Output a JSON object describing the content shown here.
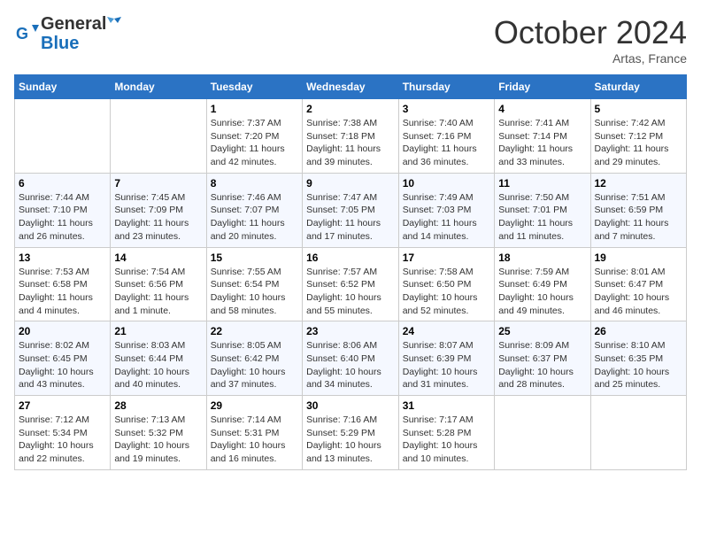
{
  "header": {
    "logo_line1": "General",
    "logo_line2": "Blue",
    "month": "October 2024",
    "location": "Artas, France"
  },
  "days_of_week": [
    "Sunday",
    "Monday",
    "Tuesday",
    "Wednesday",
    "Thursday",
    "Friday",
    "Saturday"
  ],
  "weeks": [
    [
      {
        "num": "",
        "info": ""
      },
      {
        "num": "",
        "info": ""
      },
      {
        "num": "1",
        "info": "Sunrise: 7:37 AM\nSunset: 7:20 PM\nDaylight: 11 hours and 42 minutes."
      },
      {
        "num": "2",
        "info": "Sunrise: 7:38 AM\nSunset: 7:18 PM\nDaylight: 11 hours and 39 minutes."
      },
      {
        "num": "3",
        "info": "Sunrise: 7:40 AM\nSunset: 7:16 PM\nDaylight: 11 hours and 36 minutes."
      },
      {
        "num": "4",
        "info": "Sunrise: 7:41 AM\nSunset: 7:14 PM\nDaylight: 11 hours and 33 minutes."
      },
      {
        "num": "5",
        "info": "Sunrise: 7:42 AM\nSunset: 7:12 PM\nDaylight: 11 hours and 29 minutes."
      }
    ],
    [
      {
        "num": "6",
        "info": "Sunrise: 7:44 AM\nSunset: 7:10 PM\nDaylight: 11 hours and 26 minutes."
      },
      {
        "num": "7",
        "info": "Sunrise: 7:45 AM\nSunset: 7:09 PM\nDaylight: 11 hours and 23 minutes."
      },
      {
        "num": "8",
        "info": "Sunrise: 7:46 AM\nSunset: 7:07 PM\nDaylight: 11 hours and 20 minutes."
      },
      {
        "num": "9",
        "info": "Sunrise: 7:47 AM\nSunset: 7:05 PM\nDaylight: 11 hours and 17 minutes."
      },
      {
        "num": "10",
        "info": "Sunrise: 7:49 AM\nSunset: 7:03 PM\nDaylight: 11 hours and 14 minutes."
      },
      {
        "num": "11",
        "info": "Sunrise: 7:50 AM\nSunset: 7:01 PM\nDaylight: 11 hours and 11 minutes."
      },
      {
        "num": "12",
        "info": "Sunrise: 7:51 AM\nSunset: 6:59 PM\nDaylight: 11 hours and 7 minutes."
      }
    ],
    [
      {
        "num": "13",
        "info": "Sunrise: 7:53 AM\nSunset: 6:58 PM\nDaylight: 11 hours and 4 minutes."
      },
      {
        "num": "14",
        "info": "Sunrise: 7:54 AM\nSunset: 6:56 PM\nDaylight: 11 hours and 1 minute."
      },
      {
        "num": "15",
        "info": "Sunrise: 7:55 AM\nSunset: 6:54 PM\nDaylight: 10 hours and 58 minutes."
      },
      {
        "num": "16",
        "info": "Sunrise: 7:57 AM\nSunset: 6:52 PM\nDaylight: 10 hours and 55 minutes."
      },
      {
        "num": "17",
        "info": "Sunrise: 7:58 AM\nSunset: 6:50 PM\nDaylight: 10 hours and 52 minutes."
      },
      {
        "num": "18",
        "info": "Sunrise: 7:59 AM\nSunset: 6:49 PM\nDaylight: 10 hours and 49 minutes."
      },
      {
        "num": "19",
        "info": "Sunrise: 8:01 AM\nSunset: 6:47 PM\nDaylight: 10 hours and 46 minutes."
      }
    ],
    [
      {
        "num": "20",
        "info": "Sunrise: 8:02 AM\nSunset: 6:45 PM\nDaylight: 10 hours and 43 minutes."
      },
      {
        "num": "21",
        "info": "Sunrise: 8:03 AM\nSunset: 6:44 PM\nDaylight: 10 hours and 40 minutes."
      },
      {
        "num": "22",
        "info": "Sunrise: 8:05 AM\nSunset: 6:42 PM\nDaylight: 10 hours and 37 minutes."
      },
      {
        "num": "23",
        "info": "Sunrise: 8:06 AM\nSunset: 6:40 PM\nDaylight: 10 hours and 34 minutes."
      },
      {
        "num": "24",
        "info": "Sunrise: 8:07 AM\nSunset: 6:39 PM\nDaylight: 10 hours and 31 minutes."
      },
      {
        "num": "25",
        "info": "Sunrise: 8:09 AM\nSunset: 6:37 PM\nDaylight: 10 hours and 28 minutes."
      },
      {
        "num": "26",
        "info": "Sunrise: 8:10 AM\nSunset: 6:35 PM\nDaylight: 10 hours and 25 minutes."
      }
    ],
    [
      {
        "num": "27",
        "info": "Sunrise: 7:12 AM\nSunset: 5:34 PM\nDaylight: 10 hours and 22 minutes."
      },
      {
        "num": "28",
        "info": "Sunrise: 7:13 AM\nSunset: 5:32 PM\nDaylight: 10 hours and 19 minutes."
      },
      {
        "num": "29",
        "info": "Sunrise: 7:14 AM\nSunset: 5:31 PM\nDaylight: 10 hours and 16 minutes."
      },
      {
        "num": "30",
        "info": "Sunrise: 7:16 AM\nSunset: 5:29 PM\nDaylight: 10 hours and 13 minutes."
      },
      {
        "num": "31",
        "info": "Sunrise: 7:17 AM\nSunset: 5:28 PM\nDaylight: 10 hours and 10 minutes."
      },
      {
        "num": "",
        "info": ""
      },
      {
        "num": "",
        "info": ""
      }
    ]
  ]
}
